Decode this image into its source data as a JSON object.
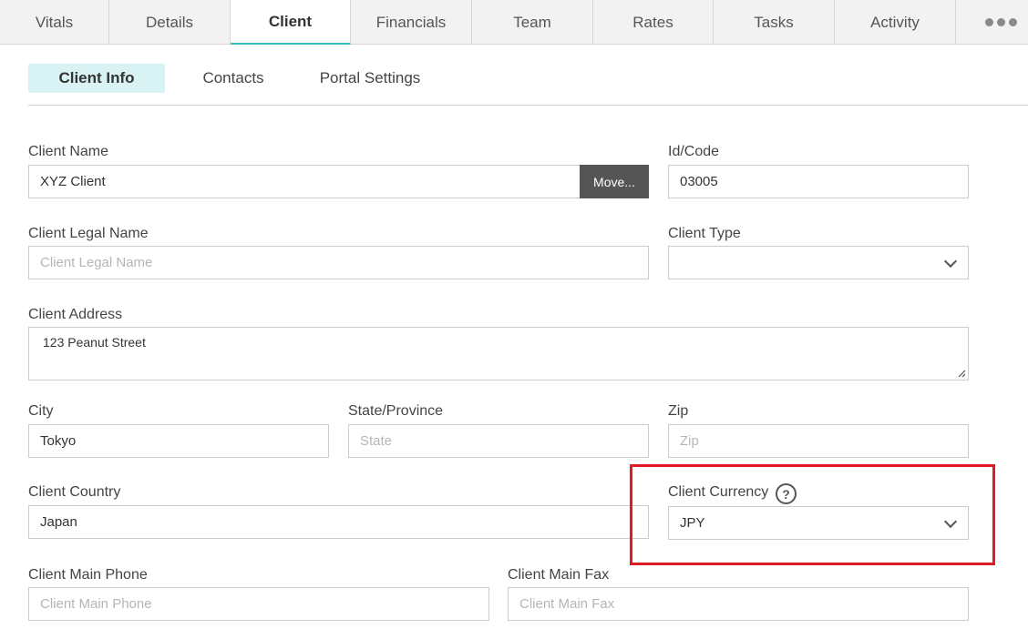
{
  "tabs": [
    {
      "label": "Vitals"
    },
    {
      "label": "Details"
    },
    {
      "label": "Client"
    },
    {
      "label": "Financials"
    },
    {
      "label": "Team"
    },
    {
      "label": "Rates"
    },
    {
      "label": "Tasks"
    },
    {
      "label": "Activity"
    }
  ],
  "active_tab": "Client",
  "subtabs": [
    {
      "label": "Client Info"
    },
    {
      "label": "Contacts"
    },
    {
      "label": "Portal Settings"
    }
  ],
  "form": {
    "client_name": {
      "label": "Client Name",
      "value": "XYZ Client",
      "move_label": "Move..."
    },
    "id_code": {
      "label": "Id/Code",
      "value": "03005"
    },
    "legal_name": {
      "label": "Client Legal Name",
      "placeholder": "Client Legal Name"
    },
    "client_type": {
      "label": "Client Type",
      "value": ""
    },
    "address": {
      "label": "Client Address",
      "value": "123 Peanut Street"
    },
    "city": {
      "label": "City",
      "value": "Tokyo"
    },
    "state": {
      "label": "State/Province",
      "placeholder": "State"
    },
    "zip": {
      "label": "Zip",
      "placeholder": "Zip"
    },
    "country": {
      "label": "Client Country",
      "value": "Japan"
    },
    "currency": {
      "label": "Client Currency",
      "value": "JPY",
      "help_glyph": "?"
    },
    "main_phone": {
      "label": "Client Main Phone",
      "placeholder": "Client Main Phone"
    },
    "main_fax": {
      "label": "Client Main Fax",
      "placeholder": "Client Main Fax"
    }
  },
  "colors": {
    "accent": "#3bb8b8",
    "highlight": "#e01b24",
    "subtab_active_bg": "#d9f3f5"
  }
}
